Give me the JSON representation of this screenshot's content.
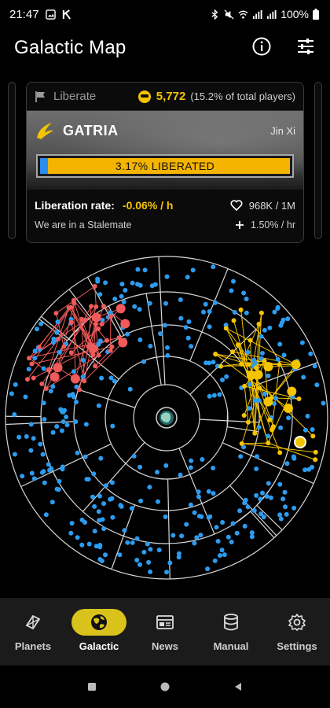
{
  "status": {
    "time": "21:47",
    "battery": "100%"
  },
  "app": {
    "title": "Galactic Map"
  },
  "card": {
    "mission_type": "Liberate",
    "players_count": "5,772",
    "players_pct": "(15.2% of total players)",
    "planet": "GATRIA",
    "sector": "Jin Xi",
    "progress_label": "3.17% LIBERATED",
    "progress": 0.0317,
    "liberation_rate_label": "Liberation rate:",
    "liberation_rate_value": "-0.06% / h",
    "health": "968K / 1M",
    "stalemate": "We are in a Stalemate",
    "regen": "1.50% / hr"
  },
  "colors": {
    "accent": "#f5c400",
    "enemy_red": "#f05a5a",
    "friendly_blue": "#2c9cf0",
    "nav_active": "#d9c21b"
  },
  "nav": {
    "items": [
      {
        "label": "Planets",
        "icon": "planets-icon",
        "active": false
      },
      {
        "label": "Galactic",
        "icon": "globe-icon",
        "active": true
      },
      {
        "label": "News",
        "icon": "news-icon",
        "active": false
      },
      {
        "label": "Manual",
        "icon": "database-icon",
        "active": false
      },
      {
        "label": "Settings",
        "icon": "gear-icon",
        "active": false
      }
    ]
  }
}
